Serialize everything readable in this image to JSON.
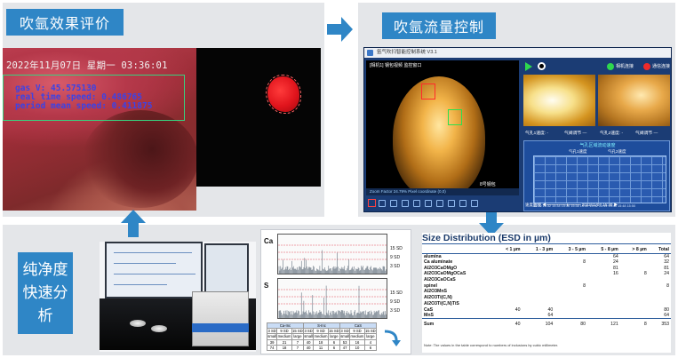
{
  "labels": {
    "eval": "吹氩效果评价",
    "flow": "吹氩流量控制",
    "purity": [
      "纯净度",
      "快速分",
      "析"
    ]
  },
  "camera": {
    "datetime": "2022年11月07日  星期一  03:36:01",
    "gas": "gas V: 45.575130",
    "real_speed": "real time speed: 0.486765",
    "mean_speed": "period mean speed: 0.411875"
  },
  "software": {
    "window_title": "氩气吹扫智能控制系统 V3.1",
    "cam_caption": "[相机1] 钢包视频  监控窗口",
    "cam_right_label": "8号钢包",
    "statusbar": "Zoom Factor 24.79%  Pixel coordinate (0,0)",
    "led_green_label": "相机连接",
    "led_red_label": "通信连接",
    "fields": [
      "气孔1速度: -",
      "气阀调节 —",
      "气孔2速度: -",
      "气阀调节 —"
    ],
    "chart_title": "气孔区域流动速度",
    "legend": [
      "气孔1速度",
      "气孔2速度"
    ],
    "x_ticks": "15:30  15:32  15:34  15:36  15:38  15:40  15:42  15:44  15:46  15:48  15:50",
    "bottom": "速度曲线  ◀━━━━━●━━━  2022/11/07 15:30  ▶"
  },
  "spectra": {
    "ca": "Ca",
    "s": "S",
    "sd_levels": [
      "15 SD",
      "9 SD",
      "3 SD"
    ],
    "table": {
      "group_headers": [
        "Ca-Inc",
        "S-Inc",
        "CaS"
      ],
      "sd_row": [
        "3 SD",
        "9 SD",
        "15 SD",
        "3 SD",
        "9 SD",
        "15 SD",
        "3 SD",
        "9 SD",
        "15 SD"
      ],
      "size_row": [
        "small",
        "medium",
        "large",
        "small",
        "medium",
        "large",
        "small",
        "medium",
        "large"
      ],
      "val_row1": [
        "39",
        "21",
        "7",
        "40",
        "18",
        "6",
        "53",
        "16",
        "4"
      ],
      "val_row2": [
        "74",
        "18",
        "7",
        "40",
        "11",
        "6",
        "47",
        "10",
        "6"
      ]
    }
  },
  "size_distribution": {
    "title": "Size Distribution (ESD in µm)",
    "columns": [
      "",
      "< 1 µm",
      "1 - 3 µm",
      "3 - 5 µm",
      "5 - 8 µm",
      "> 8 µm",
      "Total"
    ],
    "rows": [
      [
        "alumina",
        "",
        "",
        "",
        "64",
        "",
        "64"
      ],
      [
        "Ca aluminate",
        "",
        "",
        "8",
        "24",
        "",
        "32"
      ],
      [
        "Al2O3CaOMgO",
        "",
        "",
        "",
        "81",
        "",
        "81"
      ],
      [
        "Al2O3CaOMgOCaS",
        "",
        "",
        "",
        "16",
        "8",
        "24"
      ],
      [
        "Al2O3CaOCaS",
        "",
        "",
        "",
        "",
        "",
        ""
      ],
      [
        "spinel",
        "",
        "",
        "8",
        "",
        "",
        "8"
      ],
      [
        "Al2O3MnS",
        "",
        "",
        "",
        "",
        "",
        ""
      ],
      [
        "Al2O3Ti(C,N)",
        "",
        "",
        "",
        "",
        "",
        ""
      ],
      [
        "Al2O3Ti(C,N)TiS",
        "",
        "",
        "",
        "",
        "",
        ""
      ],
      [
        "CaS",
        "40",
        "40",
        "",
        "",
        "",
        "80"
      ],
      [
        "MnS",
        "",
        "64",
        "",
        "",
        "",
        "64"
      ]
    ],
    "sum": [
      "Sum",
      "40",
      "104",
      "80",
      "121",
      "8",
      "353"
    ],
    "note": "Note: The values in the table correspond to numbers of inclusions by cubic millimeter."
  },
  "colors": {
    "label_blue": "#2f86c6",
    "arrow_blue": "#2f86c6",
    "panel_grey": "#e4e6e9"
  }
}
